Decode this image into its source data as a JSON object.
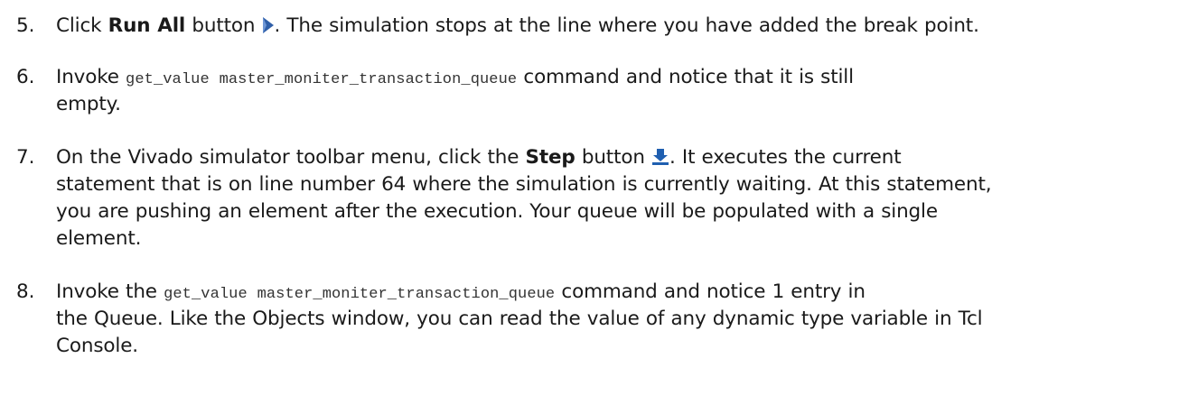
{
  "steps": [
    {
      "number": "5.",
      "parts": {
        "a": "Click ",
        "bold": "Run All",
        "b": " button ",
        "c": ". The simulation stops at the line where you have added the break point."
      },
      "icon": "run-all-icon"
    },
    {
      "number": "6.",
      "parts": {
        "a": "Invoke ",
        "code": "get_value master_moniter_transaction_queue",
        "b": " command and notice that it is still",
        "c": "empty."
      }
    },
    {
      "number": "7.",
      "parts": {
        "a": "On the Vivado simulator toolbar menu, click the ",
        "bold": "Step",
        "b": " button ",
        "c": ". It executes the current",
        "line2": "statement that is on line number 64 where the simulation is currently waiting. At this statement,",
        "line3": "you are pushing an element after the execution. Your queue will be populated with a single",
        "line4": "element."
      },
      "icon": "step-icon"
    },
    {
      "number": "8.",
      "parts": {
        "a": "Invoke the ",
        "code": "get_value master_moniter_transaction_queue",
        "b": " command and notice 1 entry in",
        "line2": "the Queue. Like the Objects window, you can read the value of any dynamic type variable in Tcl",
        "line3": "Console."
      }
    }
  ],
  "colors": {
    "run_icon": "#2f5fa8",
    "step_icon": "#1f5fb0"
  }
}
